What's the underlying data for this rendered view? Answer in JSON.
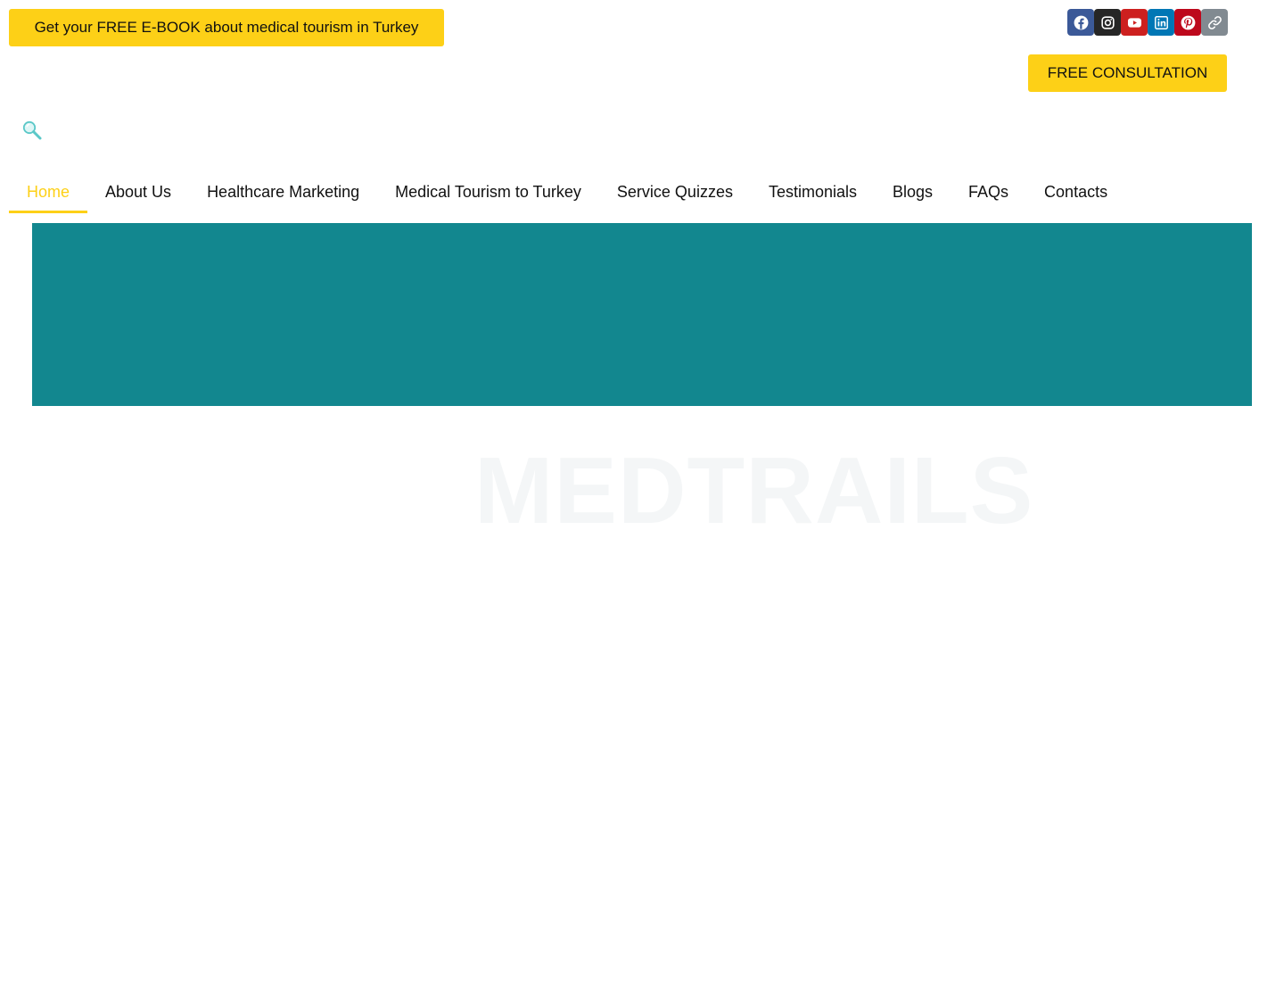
{
  "header": {
    "ebook_label": "Get your FREE E-BOOK about medical tourism in Turkey",
    "consultation_label": "FREE CONSULTATION"
  },
  "social": [
    {
      "name": "facebook-icon",
      "color": "#3B5998"
    },
    {
      "name": "instagram-icon",
      "color": "#262626"
    },
    {
      "name": "youtube-icon",
      "color": "#CD201F"
    },
    {
      "name": "linkedin-icon",
      "color": "#0077B5"
    },
    {
      "name": "pinterest-icon",
      "color": "#BD081C"
    },
    {
      "name": "link-icon",
      "color": "#818A91"
    }
  ],
  "search": {
    "icon": "search-icon",
    "color": "#5BC8C8"
  },
  "nav": {
    "items": [
      {
        "label": "Home",
        "active": true
      },
      {
        "label": "About Us"
      },
      {
        "label": "Healthcare Marketing"
      },
      {
        "label": "Medical Tourism to Turkey"
      },
      {
        "label": "Service Quizzes"
      },
      {
        "label": "Testimonials"
      },
      {
        "label": "Blogs"
      },
      {
        "label": "FAQs"
      },
      {
        "label": "Contacts"
      }
    ],
    "active_color": "#FDD017"
  },
  "hero": {
    "color": "#12878F"
  },
  "watermark": {
    "text": "MEDTRAILS"
  }
}
